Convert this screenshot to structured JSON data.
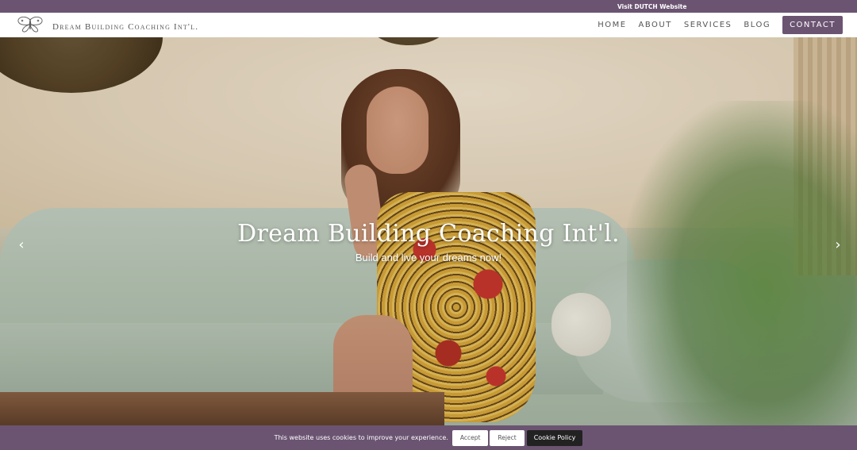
{
  "topbar": {
    "link": "Visit DUTCH Website"
  },
  "header": {
    "logo_text": "Dream Building Coaching Int'l.",
    "nav": [
      "HOME",
      "ABOUT",
      "SERVICES",
      "BLOG"
    ],
    "contact": "CONTACT"
  },
  "hero": {
    "title": "Dream Building Coaching Int'l.",
    "subtitle": "Build and live your dreams now!",
    "prev_arrow": "‹",
    "next_arrow": "›"
  },
  "cookie": {
    "message": "This website uses cookies to improve your experience.",
    "accept": "Accept",
    "reject": "Reject",
    "policy": "Cookie Policy"
  },
  "colors": {
    "brand_purple": "#6b5472",
    "white": "#ffffff",
    "policy_button": "#222222"
  },
  "icons": {
    "logo": "butterfly-icon",
    "prev": "chevron-left-icon",
    "next": "chevron-right-icon"
  }
}
